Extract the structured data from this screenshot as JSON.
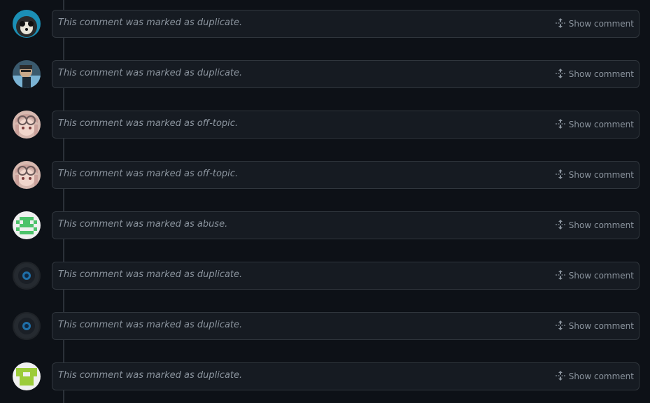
{
  "comments": [
    {
      "text": "This comment was marked as duplicate.",
      "action": "Show comment",
      "avatar": "panda-avatar"
    },
    {
      "text": "This comment was marked as duplicate.",
      "action": "Show comment",
      "avatar": "photo-avatar"
    },
    {
      "text": "This comment was marked as off-topic.",
      "action": "Show comment",
      "avatar": "anime-avatar"
    },
    {
      "text": "This comment was marked as off-topic.",
      "action": "Show comment",
      "avatar": "anime-avatar"
    },
    {
      "text": "This comment was marked as abuse.",
      "action": "Show comment",
      "avatar": "identicon-green-avatar"
    },
    {
      "text": "This comment was marked as duplicate.",
      "action": "Show comment",
      "avatar": "dark-circle-avatar"
    },
    {
      "text": "This comment was marked as duplicate.",
      "action": "Show comment",
      "avatar": "dark-circle-avatar"
    },
    {
      "text": "This comment was marked as duplicate.",
      "action": "Show comment",
      "avatar": "identicon-lime-avatar"
    }
  ],
  "colors": {
    "background": "#0d1117",
    "box_background": "#161b22",
    "border": "#30363d",
    "muted_text": "#8b949e"
  }
}
